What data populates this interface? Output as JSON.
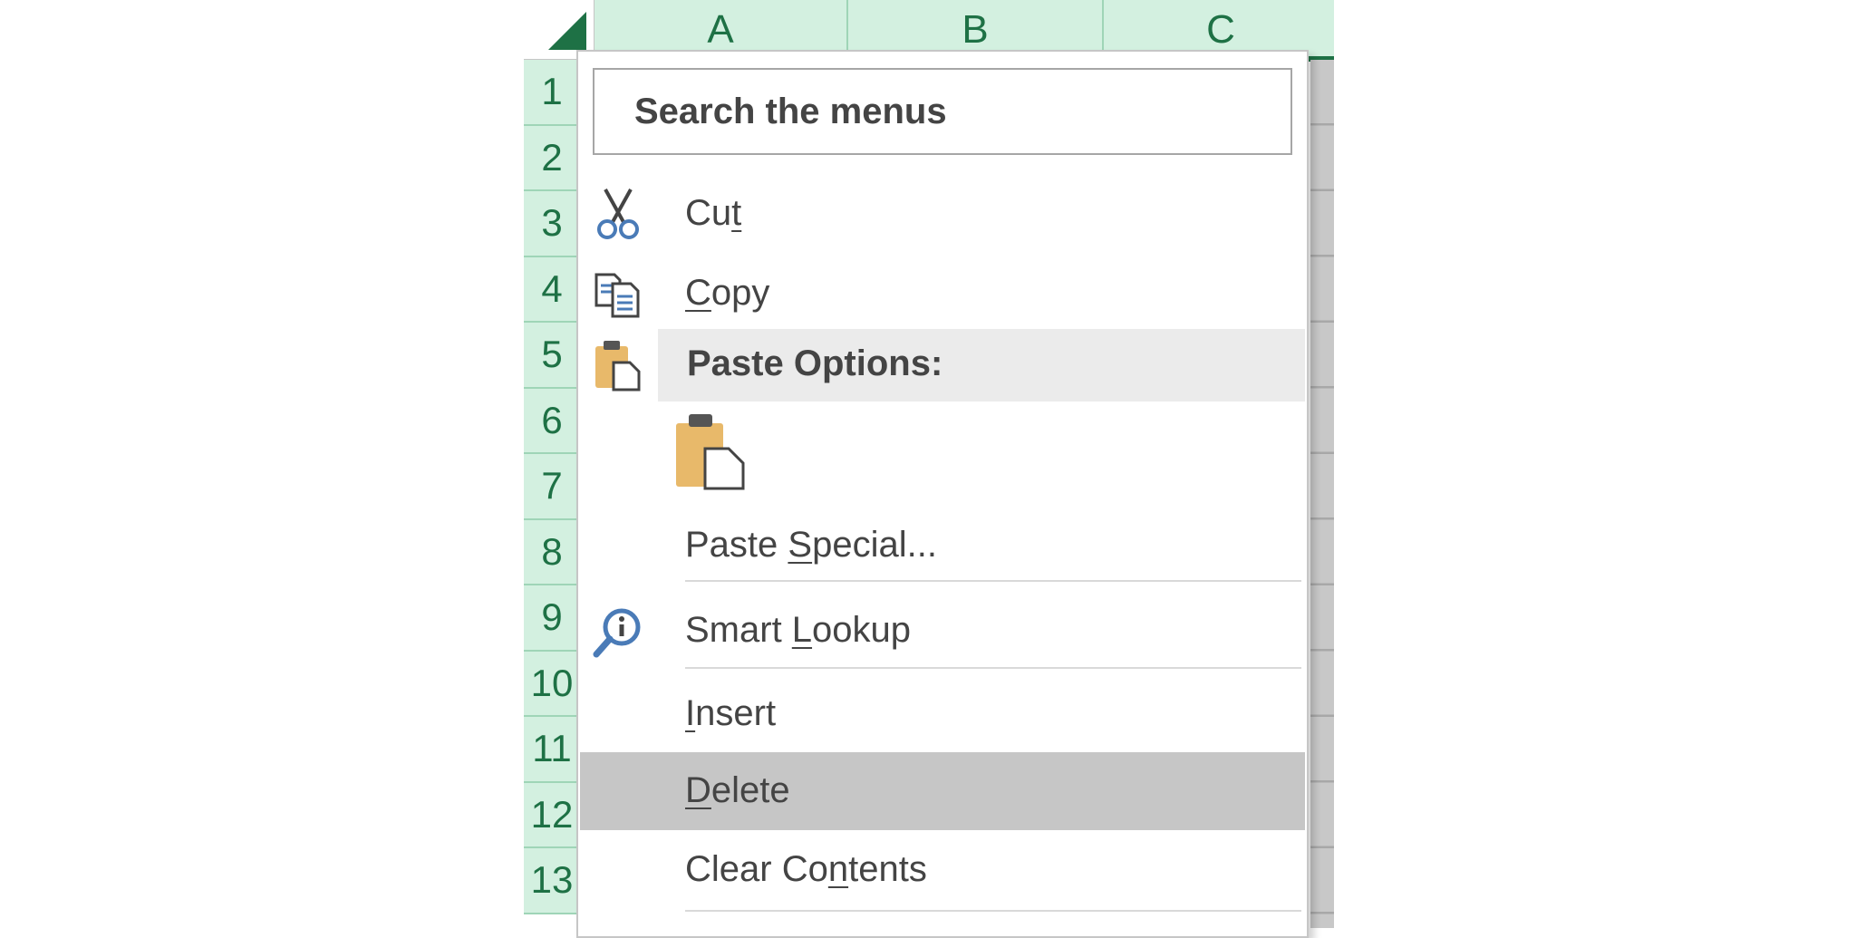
{
  "columns": [
    "A",
    "B",
    "C"
  ],
  "rows": [
    "1",
    "2",
    "3",
    "4",
    "5",
    "6",
    "7",
    "8",
    "9",
    "10",
    "11",
    "12",
    "13"
  ],
  "menu": {
    "search_placeholder": "Search the menus",
    "cut": {
      "pre": "Cu",
      "u": "t",
      "post": ""
    },
    "copy": {
      "pre": "",
      "u": "C",
      "post": "opy"
    },
    "paste_options_label": "Paste Options:",
    "paste_special": {
      "pre": "Paste ",
      "u": "S",
      "post": "pecial..."
    },
    "smart_lookup": {
      "pre": "Smart ",
      "u": "L",
      "post": "ookup"
    },
    "insert": {
      "pre": "",
      "u": "I",
      "post": "nsert"
    },
    "delete": {
      "pre": "",
      "u": "D",
      "post": "elete"
    },
    "clear_contents": {
      "pre": "Clear Co",
      "u": "n",
      "post": "tents"
    },
    "highlighted_item": "Delete"
  },
  "colors": {
    "accent_green": "#1e7145",
    "header_fill": "#d3f0e0",
    "hover_gray": "#c6c6c6",
    "paste_icon": "#e8b96a",
    "icon_blue": "#4a7bb7"
  },
  "icons": {
    "cut": "scissors-icon",
    "copy": "copy-icon",
    "paste_options": "clipboard-icon",
    "paste": "clipboard-paste-icon",
    "smart_lookup": "smart-lookup-icon"
  }
}
